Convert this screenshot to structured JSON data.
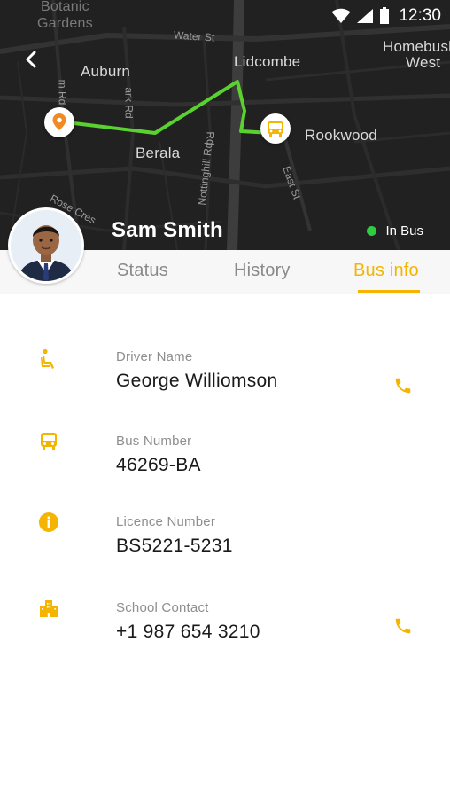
{
  "status_bar": {
    "time": "12:30",
    "icons": [
      "wifi-icon",
      "cellular-signal-icon",
      "battery-icon"
    ]
  },
  "map": {
    "places": {
      "botanic": "Botanic",
      "gardens": "Gardens",
      "auburn": "Auburn",
      "lidcombe": "Lidcombe",
      "homebush": "Homebush",
      "west": "West",
      "berala": "Berala",
      "rookwood": "Rookwood"
    },
    "streets": {
      "water_st": "Water St",
      "mark_rd": "ark Rd",
      "rd_left": "m Rd",
      "nottinghill_rd": "Nottinghill Rd",
      "rd_center": "Rd",
      "east_st": "East St",
      "rose_cres": "Rose Cres"
    },
    "route_color": "#5ad12f"
  },
  "child": {
    "name": "Sam Smith",
    "status": "In Bus",
    "status_color": "#2ecc40"
  },
  "tabs": [
    {
      "label": "Status",
      "active": false
    },
    {
      "label": "History",
      "active": false
    },
    {
      "label": "Bus info",
      "active": true
    }
  ],
  "accent_color": "#f4b400",
  "bus_info": [
    {
      "icon": "seated-person-icon",
      "label": "Driver Name",
      "value": "George Williomson",
      "call": true
    },
    {
      "icon": "bus-icon",
      "label": "Bus Number",
      "value": "46269-BA",
      "call": false
    },
    {
      "icon": "info-icon",
      "label": "Licence Number",
      "value": "BS5221-5231",
      "call": false
    },
    {
      "icon": "building-icon",
      "label": "School Contact",
      "value": "+1 987 654 3210",
      "call": true
    }
  ]
}
